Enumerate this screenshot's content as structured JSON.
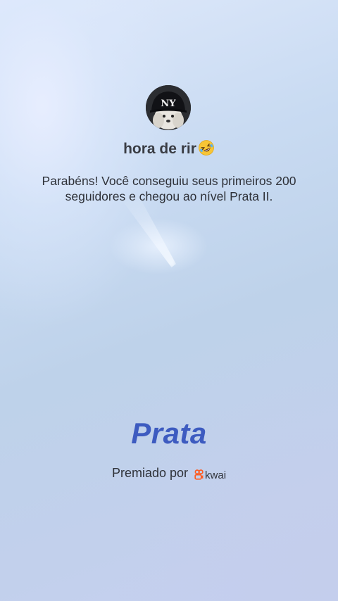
{
  "profile": {
    "avatar_icon": "dog-in-ny-cap-avatar",
    "username": "hora de rir",
    "username_emoji": "rolling-on-floor-laughing-emoji"
  },
  "message": "Parabéns! Você conseguiu seus primeiros 200 seguidores e chegou ao nível Prata II.",
  "badge": {
    "level_name": "Prata",
    "color": "#3d5bc0"
  },
  "footer": {
    "awarded_by": "Premiado por",
    "brand_name": "kwai",
    "brand_icon": "kwai-logo",
    "brand_color": "#ff5a1f"
  }
}
